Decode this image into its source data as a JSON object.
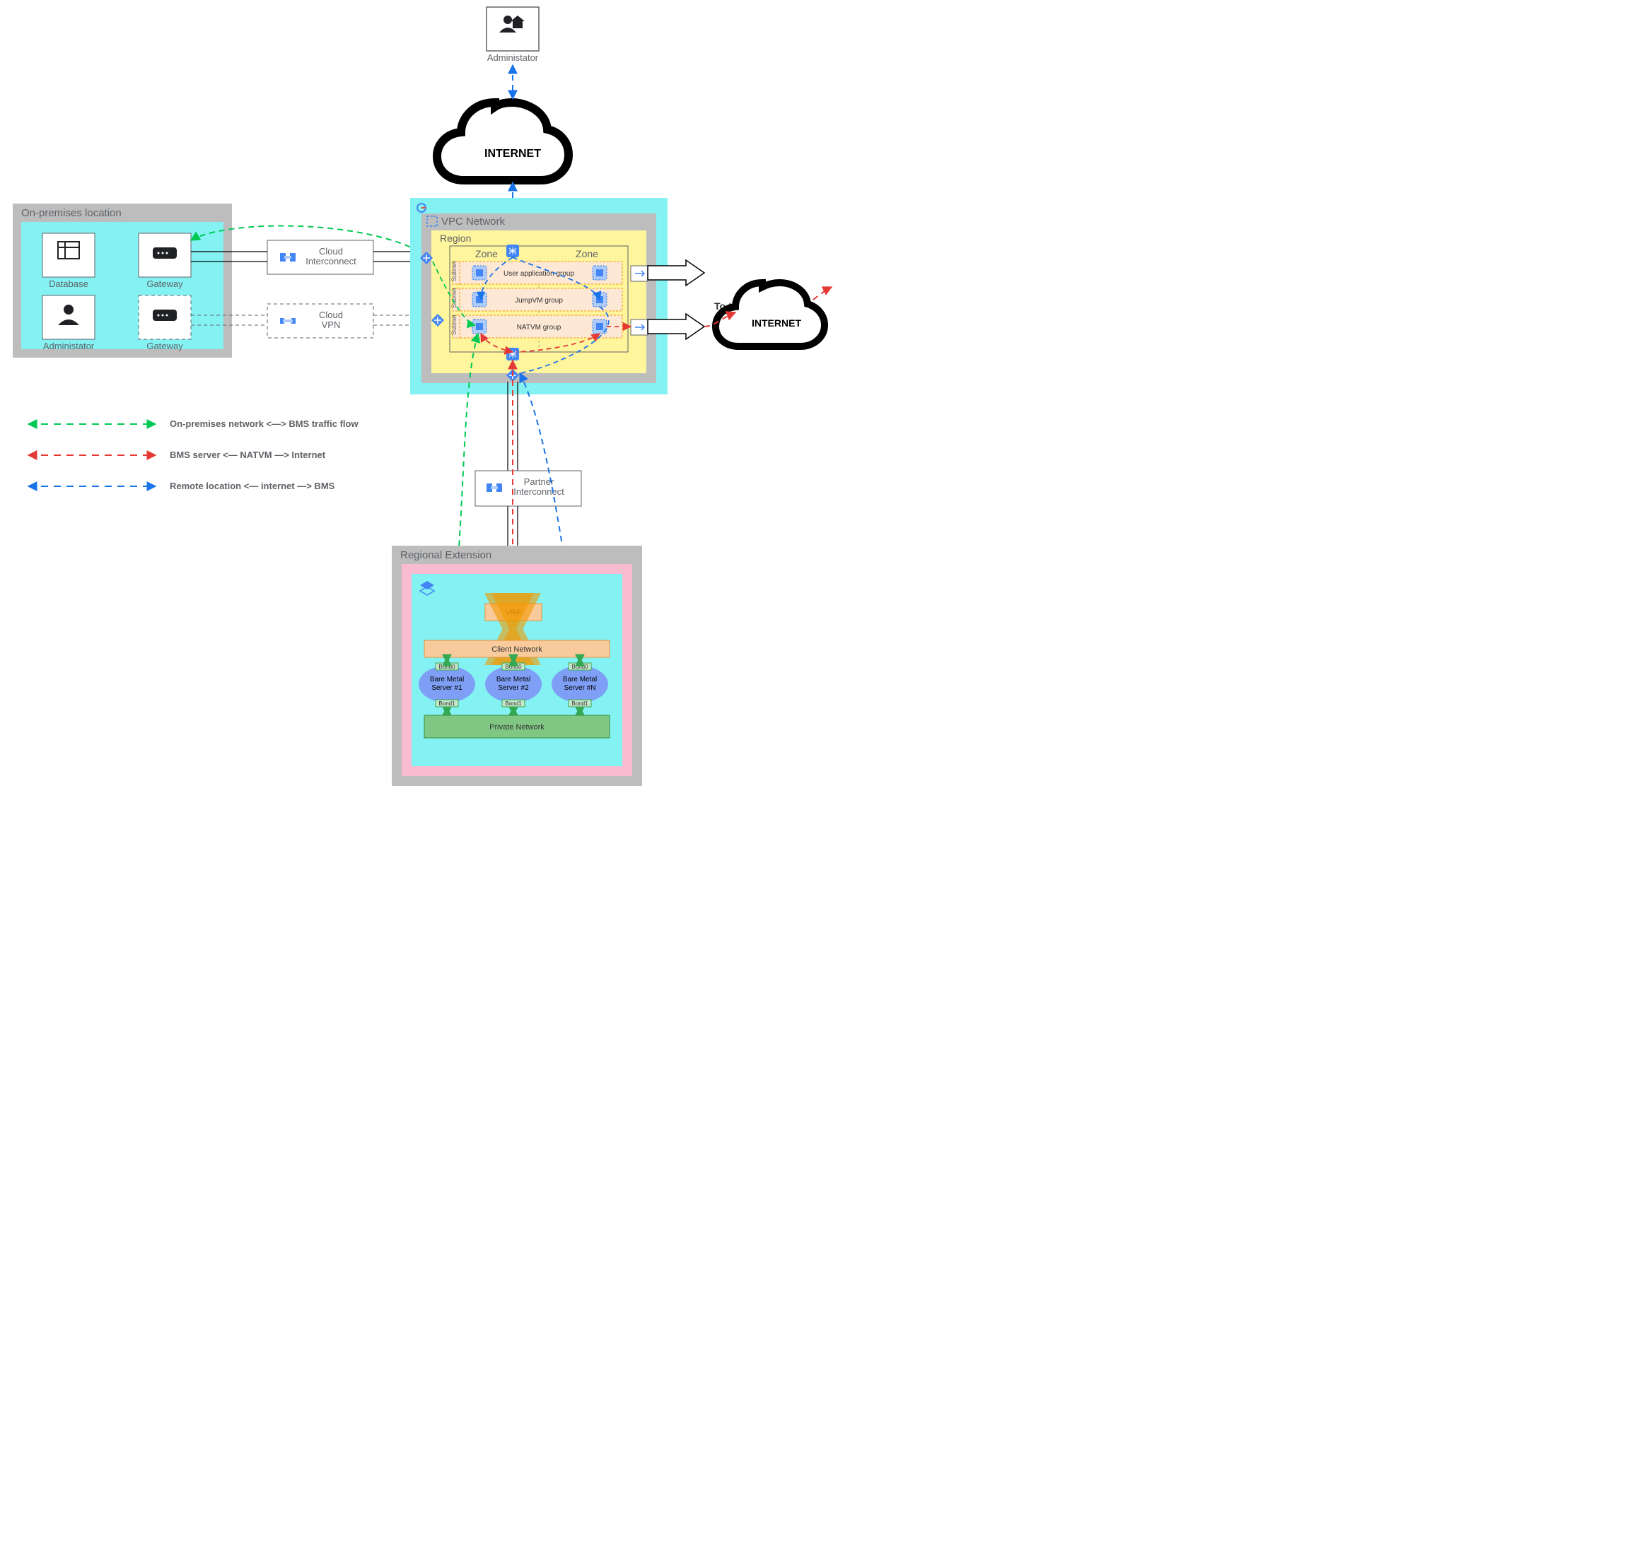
{
  "administrator_top": "Administator",
  "internet": "INTERNET",
  "onprem": {
    "title": "On-premises location",
    "database": "Database",
    "gateway": "Gateway",
    "administrator": "Administator"
  },
  "cloud_interconnect": "Cloud\nInterconnect",
  "cloud_vpn": "Cloud\nVPN",
  "vpc": {
    "title": "VPC Network",
    "region": "Region",
    "zone": "Zone",
    "subnet": "Subnet",
    "user_app_group": "User application group",
    "jumpvm_group": "JumpVM group",
    "natvm_group": "NATVM group"
  },
  "to_internet": "To the internet",
  "partner_interconnect": "Partner\nInterconnect",
  "regional_extension": {
    "title": "Regional Extension",
    "vrf": "VRF",
    "client_network": "Client Network",
    "bms1": "Bare Metal\nServer #1",
    "bms2": "Bare Metal\nServer #2",
    "bmsN": "Bare Metal\nServer #N",
    "private_network": "Private Network",
    "bond0": "Bond0",
    "bond1": "Bond1"
  },
  "legend": {
    "green": "On-premises network <—> BMS traffic flow",
    "red": "BMS server   <— NATVM —>   Internet",
    "blue": "Remote location   <— internet —>   BMS"
  }
}
